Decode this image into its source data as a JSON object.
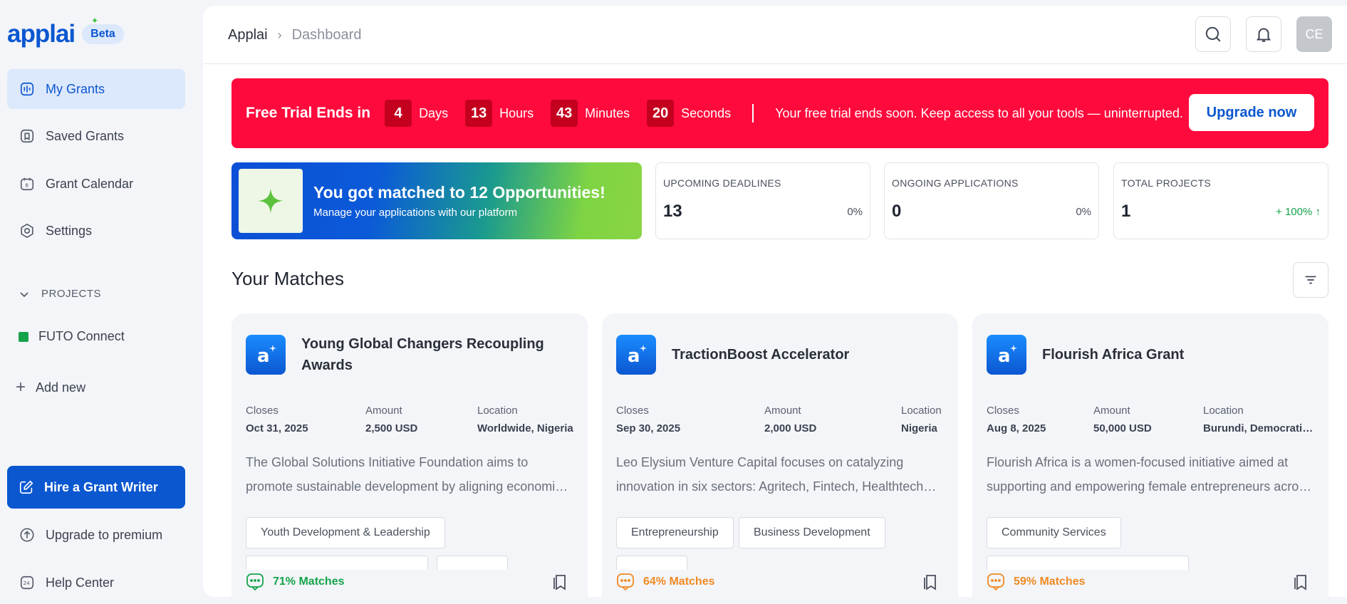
{
  "app": {
    "logo": "applai",
    "beta": "Beta"
  },
  "sidebar": {
    "items": [
      {
        "label": "My Grants",
        "icon": "grants-icon",
        "active": true
      },
      {
        "label": "Saved Grants",
        "icon": "saved-icon"
      },
      {
        "label": "Grant Calendar",
        "icon": "calendar-icon"
      },
      {
        "label": "Settings",
        "icon": "settings-icon"
      }
    ],
    "projects_heading": "PROJECTS",
    "projects": [
      {
        "label": "FUTO Connect",
        "color": "#16a34a"
      }
    ],
    "add_new": "Add new",
    "hire_button": "Hire a Grant Writer",
    "upgrade": "Upgrade to premium",
    "help": "Help Center"
  },
  "header": {
    "breadcrumb": [
      "Applai",
      "Dashboard"
    ],
    "avatar": "CE"
  },
  "trial": {
    "title": "Free Trial Ends in",
    "days": "4",
    "days_label": "Days",
    "hours": "13",
    "hours_label": "Hours",
    "minutes": "43",
    "minutes_label": "Minutes",
    "seconds": "20",
    "seconds_label": "Seconds",
    "message": "Your free trial ends soon. Keep access to all your tools — uninterrupted.",
    "button": "Upgrade now"
  },
  "match_banner": {
    "title": "You got matched to 12 Opportunities!",
    "subtitle": "Manage your applications with our platform"
  },
  "stats": [
    {
      "label": "UPCOMING DEADLINES",
      "value": "13",
      "change": "0%",
      "trend": "flat"
    },
    {
      "label": "ONGOING APPLICATIONS",
      "value": "0",
      "change": "0%",
      "trend": "flat"
    },
    {
      "label": "TOTAL PROJECTS",
      "value": "1",
      "change": "+ 100%",
      "trend": "up"
    }
  ],
  "matches": {
    "title": "Your Matches",
    "meta_labels": {
      "closes": "Closes",
      "amount": "Amount",
      "location": "Location"
    },
    "cards": [
      {
        "title": "Young Global Changers Recoupling Awards",
        "closes": "Oct 31, 2025",
        "amount": "2,500 USD",
        "location": "Worldwide, Nigeria",
        "description": "The Global Solutions Initiative Foundation aims to promote sustainable development by aligning economic interests",
        "tags": [
          "Youth Development & Leadership"
        ],
        "match": "71% Matches",
        "match_color": "#16a34a"
      },
      {
        "title": "TractionBoost Accelerator",
        "closes": "Sep 30, 2025",
        "amount": "2,000 USD",
        "location": "Nigeria",
        "description": "Leo Elysium Venture Capital focuses on catalyzing innovation in six sectors: Agritech, Fintech, Healthtech and more",
        "tags": [
          "Entrepreneurship",
          "Business Development"
        ],
        "match": "64% Matches",
        "match_color": "#f08a24"
      },
      {
        "title": "Flourish Africa Grant",
        "closes": "Aug 8, 2025",
        "amount": "50,000 USD",
        "location": "Burundi, Democratic Republic of Congo",
        "description": "Flourish Africa is a women-focused initiative aimed at supporting and empowering female entrepreneurs across Africa",
        "tags": [
          "Community Services"
        ],
        "match": "59% Matches",
        "match_color": "#f08a24"
      }
    ]
  }
}
